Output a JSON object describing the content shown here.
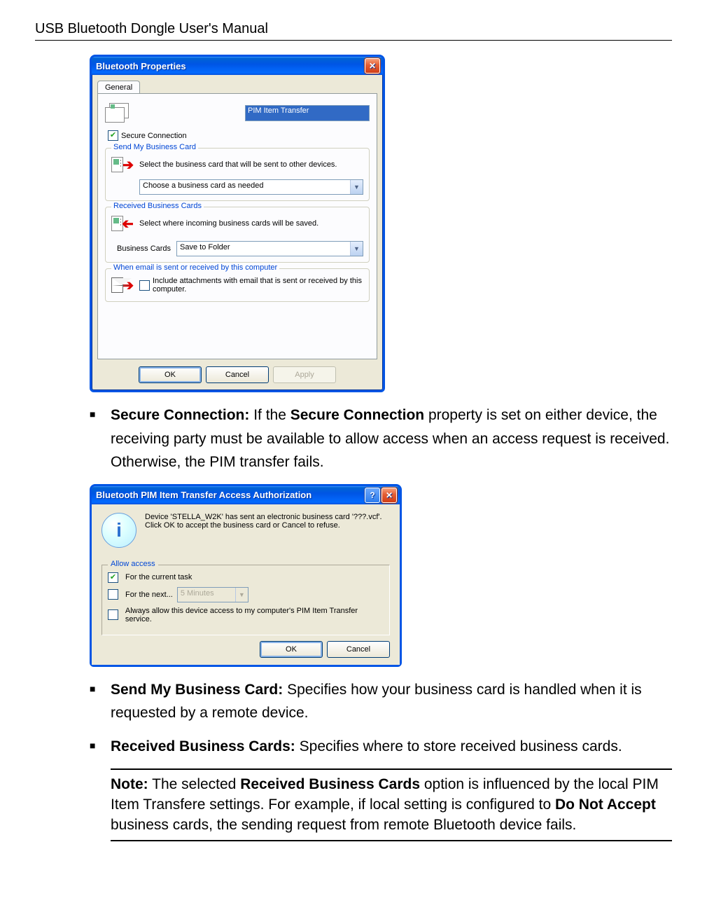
{
  "header": "USB Bluetooth Dongle User's Manual",
  "dialog1": {
    "title": "Bluetooth Properties",
    "tab": "General",
    "pim_label_value": "PIM Item Transfer",
    "secure_conn_checked": true,
    "secure_conn_label": "Secure Connection",
    "group_send": {
      "legend": "Send My Business Card",
      "text": "Select the business card that will be sent to other devices.",
      "combo": "Choose a business card as needed"
    },
    "group_recv": {
      "legend": "Received Business Cards",
      "text": "Select where incoming business cards will be saved.",
      "label": "Business Cards",
      "combo": "Save to Folder"
    },
    "group_email": {
      "legend": "When email is sent or received by this computer",
      "cb_label": "Include attachments with email that is sent or received by this computer."
    },
    "buttons": {
      "ok": "OK",
      "cancel": "Cancel",
      "apply": "Apply"
    }
  },
  "bullet_secure": {
    "lead": "Secure Connection:",
    "rest_a": " If the ",
    "bold_a": "Secure Connection",
    "rest_b": " property is set on either device, the receiving party must be available to allow access when an access request is received. Otherwise, the PIM transfer fails."
  },
  "dialog2": {
    "title": "Bluetooth PIM Item Transfer Access Authorization",
    "msg": "Device 'STELLA_W2K' has sent an electronic business card '???.vcf'. Click OK to accept the business card or Cancel to refuse.",
    "allow_legend": "Allow access",
    "opt_current": "For the current task",
    "opt_next": "For the next...",
    "opt_next_combo": "5 Minutes",
    "opt_always": "Always allow this device access to my computer's PIM Item Transfer service.",
    "buttons": {
      "ok": "OK",
      "cancel": "Cancel"
    }
  },
  "bullet_send": {
    "lead": "Send My Business Card:",
    "rest": " Specifies how your business card is handled when it is requested by a remote device."
  },
  "bullet_recv": {
    "lead": "Received Business Cards:",
    "rest": " Specifies where to store received business cards."
  },
  "note": {
    "lead": "Note:",
    "a": " The selected ",
    "b1": "Received Business Cards",
    "c": " option is influenced by the local PIM Item Transfere settings. For example, if local setting is configured to ",
    "b2": "Do Not Accept",
    "d": " business cards, the sending request from remote Bluetooth device fails."
  }
}
